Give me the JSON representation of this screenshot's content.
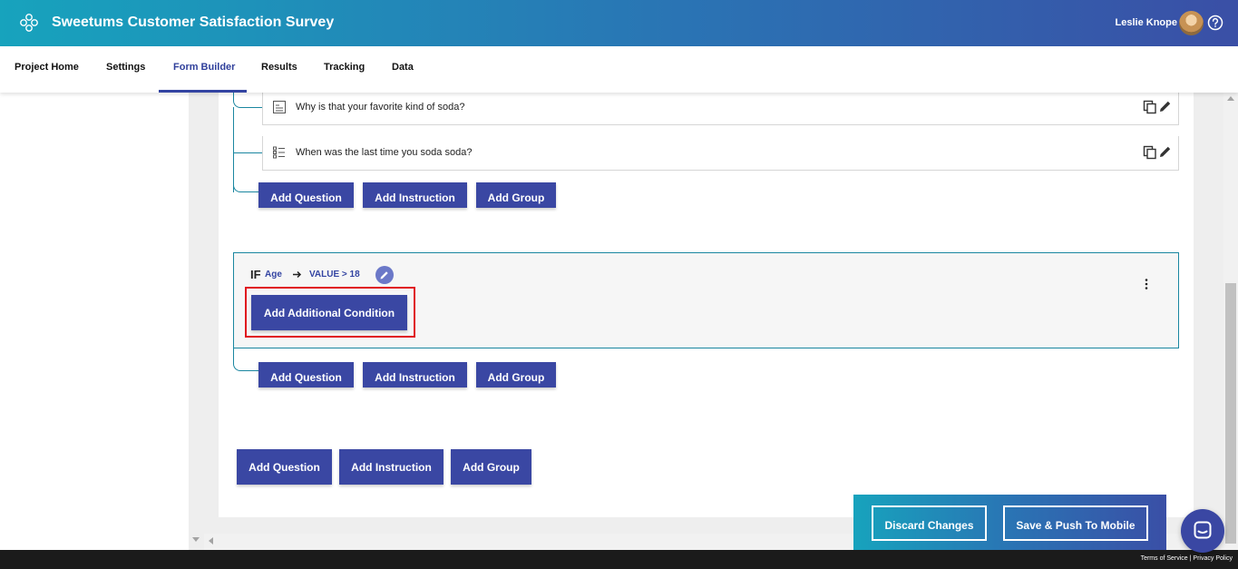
{
  "header": {
    "title": "Sweetums Customer Satisfaction Survey",
    "user_name": "Leslie Knope",
    "logo_icon": "flower-logo-icon",
    "help_icon": "help-circle-icon"
  },
  "tabs": [
    {
      "label": "Project Home",
      "active": false
    },
    {
      "label": "Settings",
      "active": false
    },
    {
      "label": "Form Builder",
      "active": true
    },
    {
      "label": "Results",
      "active": false
    },
    {
      "label": "Tracking",
      "active": false
    },
    {
      "label": "Data",
      "active": false
    }
  ],
  "questions": [
    {
      "label": "Why is that your favorite kind of soda?",
      "type_icon": "text-field-icon"
    },
    {
      "label": "When was the last time you soda soda?",
      "type_icon": "list-icon"
    }
  ],
  "group_actions": {
    "add_question": "Add Question",
    "add_instruction": "Add Instruction",
    "add_group": "Add Group"
  },
  "condition": {
    "if_label": "IF",
    "field": "Age",
    "value": "VALUE > 18",
    "add_condition_label": "Add Additional Condition"
  },
  "page_actions": {
    "add_question": "Add Question",
    "add_instruction": "Add Instruction",
    "add_group": "Add Group"
  },
  "bottom_actions": {
    "discard": "Discard Changes",
    "save_push": "Save & Push To Mobile"
  },
  "footer": {
    "terms": "Terms of Service",
    "separator": "|",
    "privacy": "Privacy Policy"
  },
  "colors": {
    "primary": "#3a47a3",
    "accent_teal": "#1a86a0",
    "highlight": "#e0141e"
  }
}
